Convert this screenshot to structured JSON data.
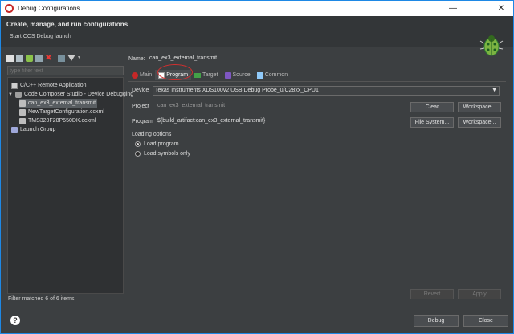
{
  "window": {
    "title": "Debug Configurations"
  },
  "header": {
    "title": "Create, manage, and run configurations",
    "subtitle": "Start CCS Debug launch"
  },
  "left": {
    "filter_placeholder": "type filter text",
    "tree": [
      {
        "label": "C/C++ Remote Application",
        "icon": "c-app-icon"
      },
      {
        "label": "Code Composer Studio - Device Debugging",
        "icon": "ccs-icon"
      },
      {
        "label": "can_ex3_external_transmit",
        "icon": "config-icon",
        "selected": true
      },
      {
        "label": "NewTargetConfiguration.ccxml",
        "icon": "config-icon"
      },
      {
        "label": "TMS320F28P650DK.ccxml",
        "icon": "config-icon"
      },
      {
        "label": "Launch Group",
        "icon": "launch-group-icon"
      }
    ],
    "status": "Filter matched 6 of 6 items"
  },
  "right": {
    "name_label": "Name:",
    "name_value": "can_ex3_external_transmit",
    "tabs": [
      {
        "label": "Main",
        "icon": "main-icon"
      },
      {
        "label": "Program",
        "icon": "program-icon",
        "active": true
      },
      {
        "label": "Target",
        "icon": "target-icon"
      },
      {
        "label": "Source",
        "icon": "source-icon"
      },
      {
        "label": "Common",
        "icon": "common-icon"
      }
    ],
    "device_label": "Device",
    "device_value": "Texas Instruments XDS100v2 USB Debug Probe_0/C28xx_CPU1",
    "project_label": "Project",
    "project_value": "can_ex3_external_transmit",
    "program_label": "Program",
    "program_value": "${build_artifact:can_ex3_external_transmit}",
    "clear_label": "Clear",
    "workspace_label": "Workspace...",
    "filesystem_label": "File System...",
    "loading_label": "Loading options",
    "load_program": "Load program",
    "load_symbols": "Load symbols only",
    "revert_label": "Revert",
    "apply_label": "Apply"
  },
  "bottom": {
    "debug_label": "Debug",
    "close_label": "Close",
    "help": "?"
  },
  "colors": {
    "accent": "#1e88e5",
    "annotation": "#d32f2f"
  }
}
